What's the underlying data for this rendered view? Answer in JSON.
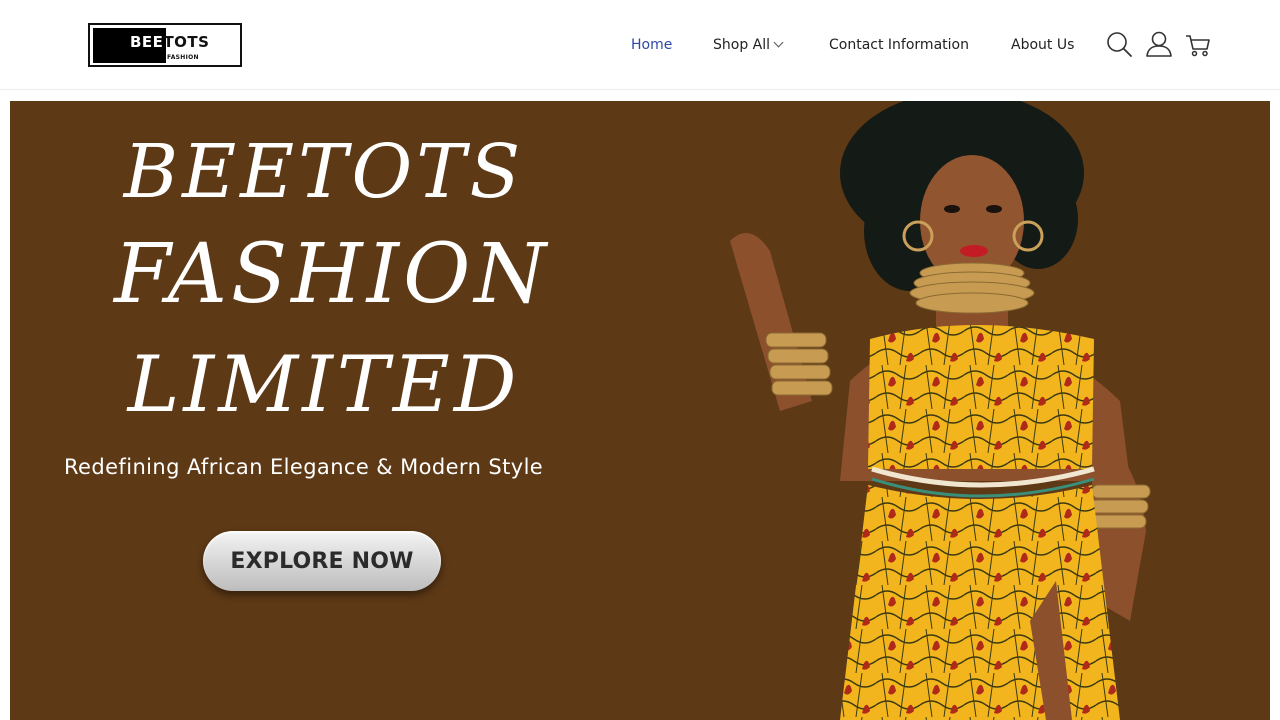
{
  "brand": {
    "logo_word_part1": "BEE",
    "logo_word_part2": "TOTS",
    "logo_sub": "FASHION"
  },
  "nav": {
    "items": [
      {
        "label": "Home",
        "active": true
      },
      {
        "label": "Shop All",
        "has_dropdown": true
      },
      {
        "label": "Contact Information"
      },
      {
        "label": "About Us"
      }
    ],
    "icons": [
      "search-icon",
      "user-icon",
      "cart-icon"
    ]
  },
  "hero": {
    "title_line1": "BEETOTS",
    "title_line2": "FASHION",
    "title_line3": "LIMITED",
    "tagline": "Redefining African Elegance & Modern Style",
    "cta_label": "EXPLORE NOW",
    "background_color": "#5d3916",
    "image": "woman-in-african-print-dress-image"
  },
  "colors": {
    "nav_active": "#2d4aa0",
    "dress_yellow": "#f2b51e"
  }
}
